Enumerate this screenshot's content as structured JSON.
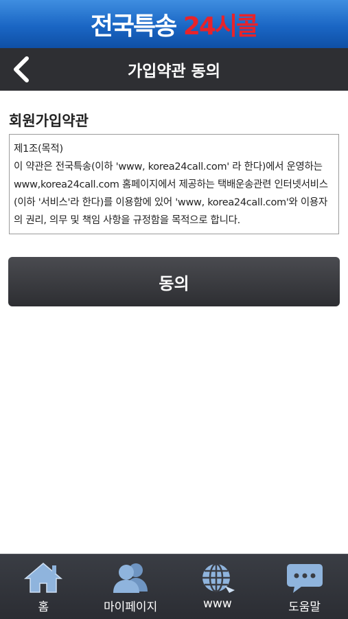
{
  "brand": {
    "name_part1": "전국특송",
    "name_part2": "24시콜"
  },
  "header": {
    "title": "가입약관 동의"
  },
  "terms": {
    "section_title": "회원가입약관",
    "text": "제1조(목적)\n이 약관은 전국특송(이하 'www, korea24call.com' 라 한다)에서 운영하는 www,korea24call.com 홈페이지에서 제공하는 택배운송관련 인터넷서비스(이하 '서비스'라 한다)를 이용함에 있어 'www, korea24call.com'와 이용자의 권리, 의무 및 책임 사항을 규정함을 목적으로 합니다."
  },
  "agree_button": {
    "label": "동의"
  },
  "tabs": [
    {
      "label": "홈",
      "icon": "home-icon"
    },
    {
      "label": "마이페이지",
      "icon": "users-icon"
    },
    {
      "label": "www",
      "icon": "globe-icon"
    },
    {
      "label": "도움말",
      "icon": "chat-bubble-icon"
    }
  ],
  "colors": {
    "brand_blue": "#1a66c4",
    "brand_red": "#e8232a",
    "dark_bar": "#2e2f33",
    "icon_blue": "#8fb4dd"
  }
}
